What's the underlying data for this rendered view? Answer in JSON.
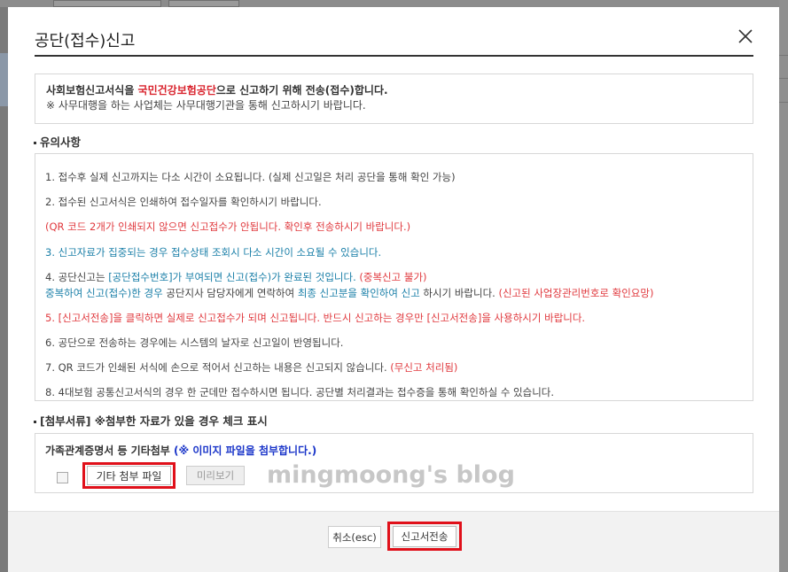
{
  "dialog": {
    "title": "공단(접수)신고"
  },
  "notice": {
    "line1_pre": "사회보험신고서식을 ",
    "line1_agency": "국민건강보험공단",
    "line1_post": "으로 신고하기 위해 전송(접수)합니다.",
    "line2": "※ 사무대행을 하는 사업체는 사무대행기관을 통해 신고하시기 바랍니다."
  },
  "precautions": {
    "heading": "유의사항",
    "note1": "1. 접수후 실제 신고까지는 다소 시간이 소요됩니다. (실제 신고일은 처리 공단을 통해 확인 가능)",
    "note2": "2. 접수된 신고서식은 인쇄하여 접수일자를 확인하시기 바랍니다.",
    "note3": "(QR 코드 2개가 인쇄되지 않으면 신고접수가 안됩니다. 확인후 전송하시기 바랍니다.)",
    "note4": "3. 신고자료가 집중되는 경우 접수상태 조회시 다소 시간이 소요될 수 있습니다.",
    "note5_a": "4. 공단신고는 ",
    "note5_b": "[공단접수번호]가 부여되면 신고(접수)가 완료된 것입니다.",
    "note5_c": " (중복신고 불가)",
    "note6_a": "중복하여 신고(접수)한 경우 ",
    "note6_b": "공단지사 담당자에게 연락하여 ",
    "note6_c": "최종 신고분을 확인하여 신고",
    "note6_d": " 하시기 바랍니다. ",
    "note6_e": "(신고된 사업장관리번호로 확인요망)",
    "note7": "5. [신고서전송]을 클릭하면 실제로 신고접수가 되며 신고됩니다. 반드시 신고하는 경우만 [신고서전송]을 사용하시기 바랍니다.",
    "note8": "6. 공단으로 전송하는 경우에는 시스템의 날자로 신고일이 반영됩니다.",
    "note9_a": "7. QR 코드가 인쇄된 서식에 손으로 적어서 신고하는 내용은 신고되지 않습니다. ",
    "note9_b": "(무신고 처리됨)",
    "note10": "8. 4대보험 공통신고서식의 경우 한 군데만 접수하시면 됩니다. 공단별 처리결과는 접수증을 통해 확인하실 수 있습니다."
  },
  "attachments": {
    "heading": "[첨부서류] ※첨부한 자료가 있을 경우 체크 표시",
    "box_title": "가족관계증명서 등 기타첨부 ",
    "box_hint": "(※ 이미지 파일을 첨부합니다.)",
    "file_button": "기타 첨부 파일",
    "preview_button": "미리보기",
    "checked": false
  },
  "watermark": "mingmoong's blog",
  "footer": {
    "cancel_button": "취소(esc)",
    "send_button": "신고서전송"
  },
  "colors": {
    "accent_red": "#e0393e",
    "highlight_red": "#d9232d",
    "blue": "#1a6fc9",
    "frame_red": "#e0101a"
  }
}
